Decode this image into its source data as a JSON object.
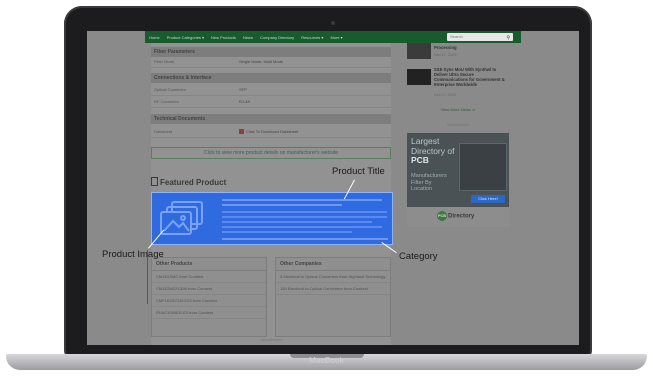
{
  "device": {
    "brand": "MacBook"
  },
  "nav": {
    "items": [
      "Home",
      "Product Categories ▾",
      "New Products",
      "News",
      "Company Directory",
      "Resources ▾",
      "More ▾"
    ],
    "search_placeholder": "Search"
  },
  "specs": {
    "sections": [
      {
        "title": "Fiber Parameters",
        "rows": [
          {
            "key": "Fiber Mode",
            "value": "Single Mode, Multi Mode"
          }
        ]
      },
      {
        "title": "Connections & Interface",
        "rows": [
          {
            "key": "Optical Connector",
            "value": "SFP"
          },
          {
            "key": "RF Connector",
            "value": "RJ-45"
          }
        ]
      },
      {
        "title": "Technical Documents",
        "rows": [
          {
            "key": "Datasheet",
            "value": "Click To Download Datasheet"
          }
        ]
      }
    ],
    "more_details": "Click to view more product details on manufacturer's website"
  },
  "featured": {
    "title": "Featured Product"
  },
  "other_products": {
    "title": "Other Products",
    "items": [
      "CM1E2SMC from Comtest",
      "CM1E2MCFCEM from Comtest",
      "CMF1E2SC1M-2G2 from Comtest",
      "RLMC1000ER-E2 from Comtest"
    ]
  },
  "other_companies": {
    "title": "Other Companies",
    "items": [
      "3 Electrical to Optical Converters from Highland Technology",
      "159 Electrical to Optical Converters from Comtest"
    ]
  },
  "sidebar": {
    "news": [
      {
        "title": "Processing",
        "date": "Dec 17, 2021"
      },
      {
        "title": "SSE Syns MoU With Synthwl to Deliver Ultra Secure Communications for Government & Enterprise Worldwide",
        "date": "Dec 17, 2021"
      }
    ],
    "view_more": "View More News ⇒",
    "ad_label": "Advertisement",
    "ad": {
      "line1": "Largest",
      "line2": "Directory of",
      "line3": "PCB",
      "line4": "Manufacturers",
      "line5": "Filter By",
      "line6": "Location",
      "button": "Click Here!",
      "logo_circle": "PCB",
      "logo_text": "Directory"
    }
  },
  "footer_ad_label": "Advertisement",
  "annotations": {
    "product_title": "Product Title",
    "product_image": "Product Image",
    "category": "Category"
  },
  "colors": {
    "highlight": "#2f6ae0",
    "nav": "#175c2c"
  }
}
